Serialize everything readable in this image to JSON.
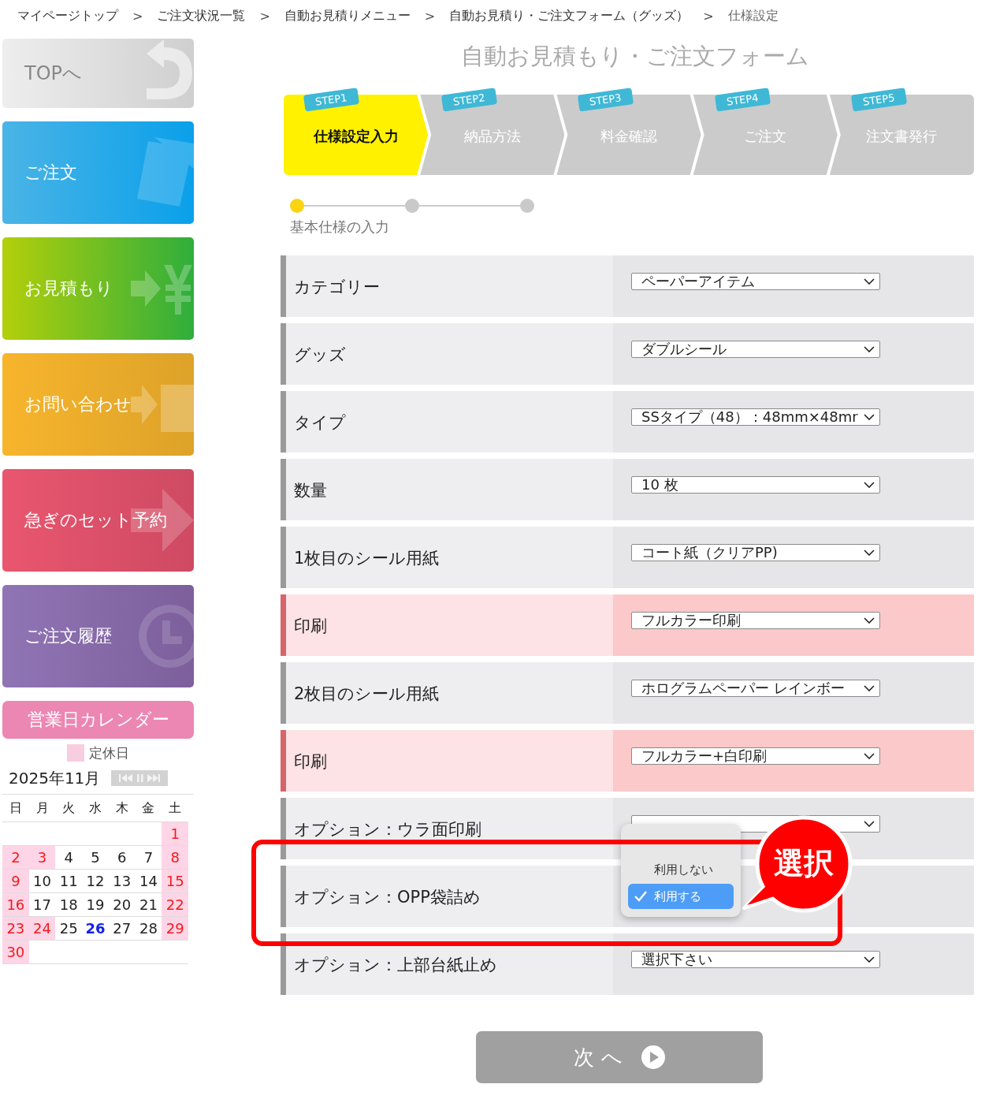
{
  "breadcrumbs": [
    {
      "label": "マイページトップ",
      "sep": ">"
    },
    {
      "label": "ご注文状況一覧",
      "sep": ">"
    },
    {
      "label": "自動お見積りメニュー",
      "sep": ">"
    },
    {
      "label": "自動お見積り・ご注文フォーム（グッズ）",
      "sep": ">"
    },
    {
      "label": "仕様設定"
    }
  ],
  "sidebar": {
    "items": [
      {
        "kind": "top",
        "label": "TOPへ"
      },
      {
        "kind": "order",
        "label": "ご注文"
      },
      {
        "kind": "estimate",
        "label": "お見積もり"
      },
      {
        "kind": "contact",
        "label": "お問い合わせ"
      },
      {
        "kind": "reserve",
        "label": "急ぎのセット予約"
      },
      {
        "kind": "history",
        "label": "ご注文履歴"
      }
    ],
    "calendar": {
      "title": "営業日カレンダー",
      "legend": "定休日",
      "month": "2025年11月",
      "weekdays": [
        "日",
        "月",
        "火",
        "水",
        "木",
        "金",
        "土"
      ],
      "weeks": [
        [
          {
            "kind": "blank"
          },
          {
            "kind": "blank"
          },
          {
            "kind": "blank"
          },
          {
            "kind": "blank"
          },
          {
            "kind": "blank"
          },
          {
            "kind": "blank"
          },
          {
            "kind": "day",
            "day": "1",
            "holiday": true,
            "today": false
          }
        ],
        [
          {
            "kind": "day",
            "day": "2",
            "holiday": true,
            "today": false
          },
          {
            "kind": "day",
            "day": "3",
            "holiday": true,
            "today": false
          },
          {
            "kind": "day",
            "day": "4",
            "holiday": false,
            "today": false
          },
          {
            "kind": "day",
            "day": "5",
            "holiday": false,
            "today": false
          },
          {
            "kind": "day",
            "day": "6",
            "holiday": false,
            "today": false
          },
          {
            "kind": "day",
            "day": "7",
            "holiday": false,
            "today": false
          },
          {
            "kind": "day",
            "day": "8",
            "holiday": true,
            "today": false
          }
        ],
        [
          {
            "kind": "day",
            "day": "9",
            "holiday": true,
            "today": false
          },
          {
            "kind": "day",
            "day": "10",
            "holiday": false,
            "today": false
          },
          {
            "kind": "day",
            "day": "11",
            "holiday": false,
            "today": false
          },
          {
            "kind": "day",
            "day": "12",
            "holiday": false,
            "today": false
          },
          {
            "kind": "day",
            "day": "13",
            "holiday": false,
            "today": false
          },
          {
            "kind": "day",
            "day": "14",
            "holiday": false,
            "today": false
          },
          {
            "kind": "day",
            "day": "15",
            "holiday": true,
            "today": false
          }
        ],
        [
          {
            "kind": "day",
            "day": "16",
            "holiday": true,
            "today": false
          },
          {
            "kind": "day",
            "day": "17",
            "holiday": false,
            "today": false
          },
          {
            "kind": "day",
            "day": "18",
            "holiday": false,
            "today": false
          },
          {
            "kind": "day",
            "day": "19",
            "holiday": false,
            "today": false
          },
          {
            "kind": "day",
            "day": "20",
            "holiday": false,
            "today": false
          },
          {
            "kind": "day",
            "day": "21",
            "holiday": false,
            "today": false
          },
          {
            "kind": "day",
            "day": "22",
            "holiday": true,
            "today": false
          }
        ],
        [
          {
            "kind": "day",
            "day": "23",
            "holiday": true,
            "today": false
          },
          {
            "kind": "day",
            "day": "24",
            "holiday": true,
            "today": false
          },
          {
            "kind": "day",
            "day": "25",
            "holiday": false,
            "today": false
          },
          {
            "kind": "day",
            "day": "26",
            "holiday": false,
            "today": true
          },
          {
            "kind": "day",
            "day": "27",
            "holiday": false,
            "today": false
          },
          {
            "kind": "day",
            "day": "28",
            "holiday": false,
            "today": false
          },
          {
            "kind": "day",
            "day": "29",
            "holiday": true,
            "today": false
          }
        ],
        [
          {
            "kind": "day",
            "day": "30",
            "holiday": true,
            "today": false
          }
        ]
      ]
    }
  },
  "title": "自動お見積もり・ご注文フォーム",
  "steps": [
    {
      "badge": "STEP1",
      "label": "仕様設定入力",
      "selected": true
    },
    {
      "badge": "STEP2",
      "label": "納品方法",
      "selected": false
    },
    {
      "badge": "STEP3",
      "label": "料金確認",
      "selected": false
    },
    {
      "badge": "STEP4",
      "label": "ご注文",
      "selected": false
    },
    {
      "badge": "STEP5",
      "label": "注文書発行",
      "selected": false
    }
  ],
  "progress": {
    "dots": [
      {
        "selected": true
      },
      {
        "selected": false
      },
      {
        "selected": false
      }
    ],
    "label": "基本仕様の入力"
  },
  "rows": [
    {
      "label": "カテゴリー",
      "value": "ペーパーアイテム",
      "highlight": false
    },
    {
      "label": "グッズ",
      "value": "ダブルシール",
      "highlight": false
    },
    {
      "label": "タイプ",
      "value": "SSタイプ（48）：48mm×48mr",
      "highlight": false
    },
    {
      "label": "数量",
      "value": "10 枚",
      "highlight": false
    },
    {
      "label": "1枚目のシール用紙",
      "value": "コート紙（クリアPP)",
      "highlight": false
    },
    {
      "label": "印刷",
      "value": "フルカラー印刷",
      "highlight": true
    },
    {
      "label": "2枚目のシール用紙",
      "value": "ホログラムペーパー レインボー",
      "highlight": false
    },
    {
      "label": "印刷",
      "value": "フルカラー+白印刷",
      "highlight": true
    },
    {
      "label": "オプション：ウラ面印刷",
      "highlight": false,
      "kind": "select"
    },
    {
      "label": "オプション：OPP袋詰め",
      "highlight": false,
      "kind": "menu"
    },
    {
      "label": "オプション：上部台紙止め",
      "value": "選択下さい",
      "highlight": false
    }
  ],
  "dropdown": {
    "options": [
      {
        "label": "利用しない",
        "selected": false
      },
      {
        "label": "利用する",
        "selected": true
      }
    ]
  },
  "callout": "選択",
  "next_button": "次 へ"
}
